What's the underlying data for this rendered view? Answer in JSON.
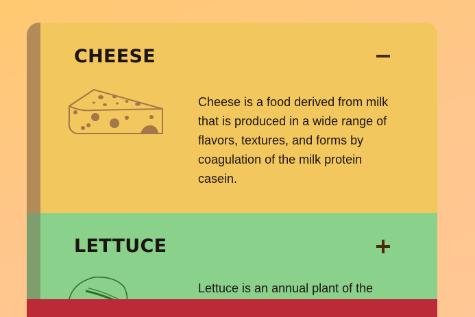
{
  "accordion": {
    "items": [
      {
        "title": "CHEESE",
        "toggle_icon": "minus-icon",
        "illustration": "cheese-icon",
        "description": "Cheese is a food derived from milk that is produced in a wide range of flavors, textures, and forms by coagulation of the milk protein casein.",
        "state": "expanded",
        "color": "#f1c75e"
      },
      {
        "title": "LETTUCE",
        "toggle_icon": "plus-icon",
        "illustration": "lettuce-icon",
        "description": "Lettuce is an annual plant of the",
        "state": "collapsed",
        "color": "#8ad18b"
      },
      {
        "color": "#bd2a37"
      }
    ]
  }
}
